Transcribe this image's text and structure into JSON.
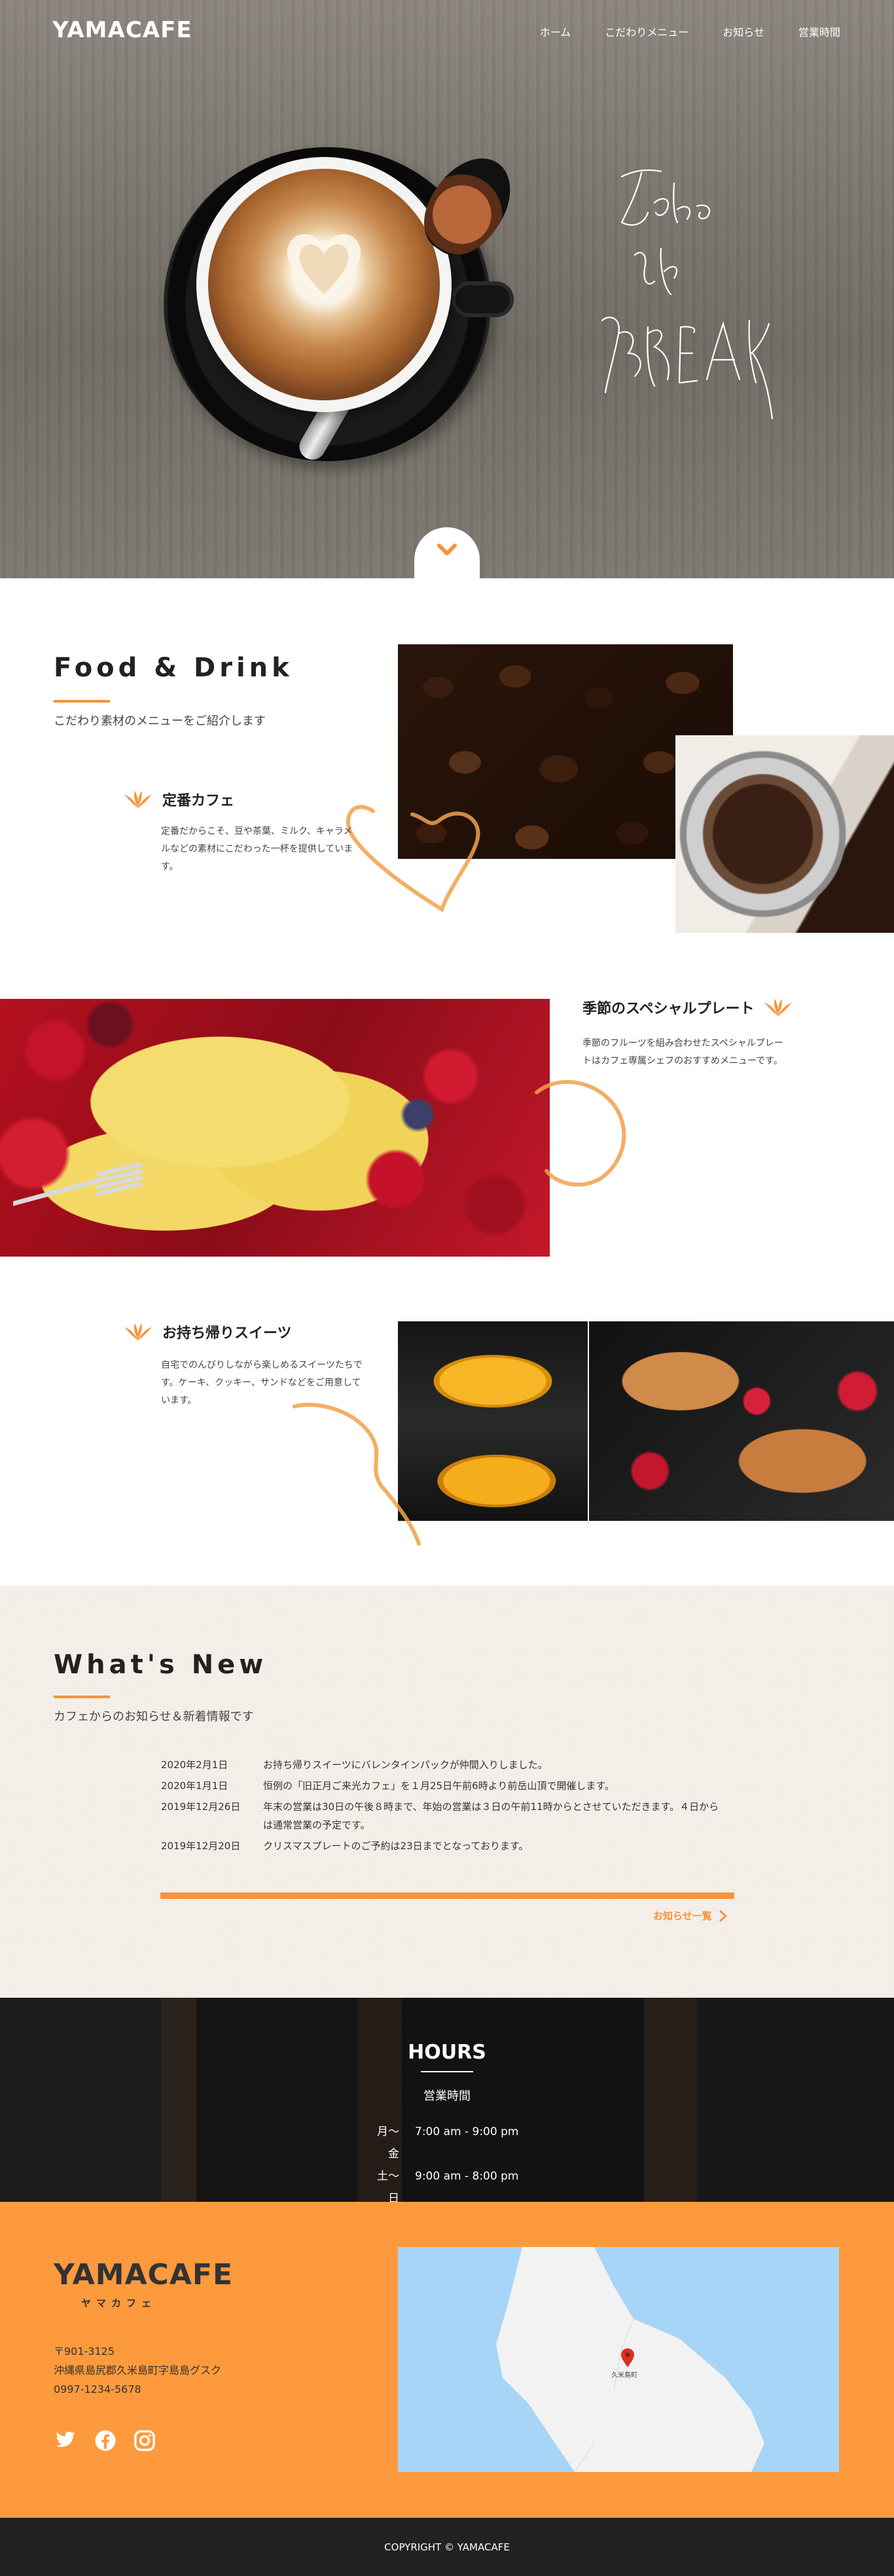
{
  "brand": {
    "logo": "YAMACAFE",
    "logo_sub": "ヤマカフェ"
  },
  "nav": {
    "items": [
      "ホーム",
      "こだわりメニュー",
      "お知らせ",
      "営業時間"
    ]
  },
  "food": {
    "title": "Food & Drink",
    "subtitle": "こだわり素材のメニューをご紹介します",
    "items": [
      {
        "title": "定番カフェ",
        "text": "定番だからこそ、豆や茶葉、ミルク、キャラメルなどの素材にこだわった一杯を提供しています。"
      },
      {
        "title": "季節のスペシャルプレート",
        "text": "季節のフルーツを組み合わせたスペシャルプレートはカフェ専属シェフのおすすめメニューです。"
      },
      {
        "title": "お持ち帰りスイーツ",
        "text": "自宅でのんびりしながら楽しめるスイーツたちです。ケーキ、クッキー、サンドなどをご用意しています。"
      }
    ]
  },
  "news": {
    "title": "What's New",
    "subtitle": "カフェからのお知らせ＆新着情報です",
    "items": [
      {
        "date": "2020年2月1日",
        "text": "お持ち帰りスイーツにバレンタインパックが仲間入りしました。"
      },
      {
        "date": "2020年1月1日",
        "text": "恒例の「旧正月ご来光カフェ」を１月25日午前6時より前岳山頂で開催します。"
      },
      {
        "date": "2019年12月26日",
        "text": "年末の営業は30日の午後８時まで、年始の営業は３日の午前11時からとさせていただきます。４日からは通常営業の予定です。"
      },
      {
        "date": "2019年12月20日",
        "text": "クリスマスプレートのご予約は23日までとなっております。"
      }
    ],
    "more": "お知らせ一覧"
  },
  "hours": {
    "title": "HOURS",
    "subtitle": "営業時間",
    "rows": [
      {
        "day": "月〜金",
        "time": "7:00 am - 9:00 pm"
      },
      {
        "day": "土〜日",
        "time": "9:00 am - 8:00 pm"
      }
    ]
  },
  "footer": {
    "postal": "〒901-3125",
    "address": "沖縄県島尻郡久米島町字島島グスク",
    "phone": "0997-1234-5678",
    "map_label": "久米島町"
  },
  "copyright": "COPYRIGHT © YAMACAFE",
  "icons": [
    "chevron-down-icon",
    "leaf-icon",
    "twitter-icon",
    "facebook-icon",
    "instagram-icon",
    "chevron-right-icon",
    "map-pin-icon"
  ],
  "colors": {
    "accent": "#f7933a",
    "footer": "#fd9a3d",
    "dark": "#222222"
  }
}
